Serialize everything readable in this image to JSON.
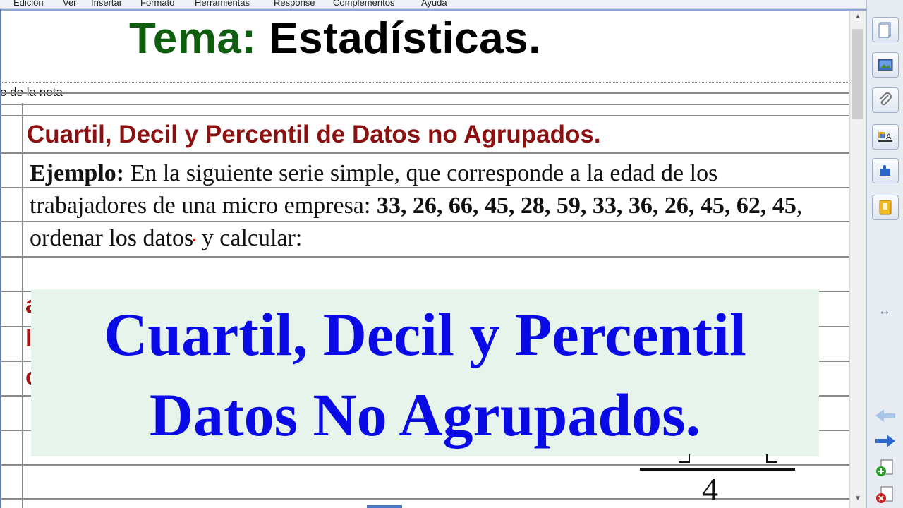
{
  "menu": [
    "Edición",
    "Ver",
    "Insertar",
    "Formato",
    "Herramientas",
    "Response",
    "Complementos",
    "Ayuda"
  ],
  "title": {
    "part1": "Tema:",
    "part2": "Estadísticas."
  },
  "note_label": "o de la nota",
  "heading": "Cuartil, Decil y Percentil de Datos  no Agrupados.",
  "paragraph": {
    "label": "Ejemplo:",
    "text1": " En la siguiente serie simple, que corresponde a la edad de los trabajadores de una micro empresa: ",
    "data_bold": "33, 26, 66, 45, 28, 59, 33, 36, 26, 45, 62, 45",
    "text2": ", ordenar los datos",
    "text3": " y calcular:"
  },
  "overlay": {
    "line1": "Cuartil, Decil y Percentil",
    "line2": "Datos No Agrupados."
  },
  "left_fragments": [
    "a",
    "l",
    "c"
  ],
  "math_denominator": "4",
  "colors": {
    "title_green": "#0f5e10",
    "heading_red": "#8b1010",
    "overlay_blue": "#0a0ae6",
    "overlay_bg": "#e6f4ec"
  },
  "side_icons": [
    "page-icon",
    "image-icon",
    "attach-icon",
    "text-format-icon",
    "puzzle-icon",
    "gallery-icon",
    "resize-icon",
    "back-arrow-icon",
    "forward-arrow-icon",
    "add-page-icon",
    "delete-page-icon"
  ]
}
